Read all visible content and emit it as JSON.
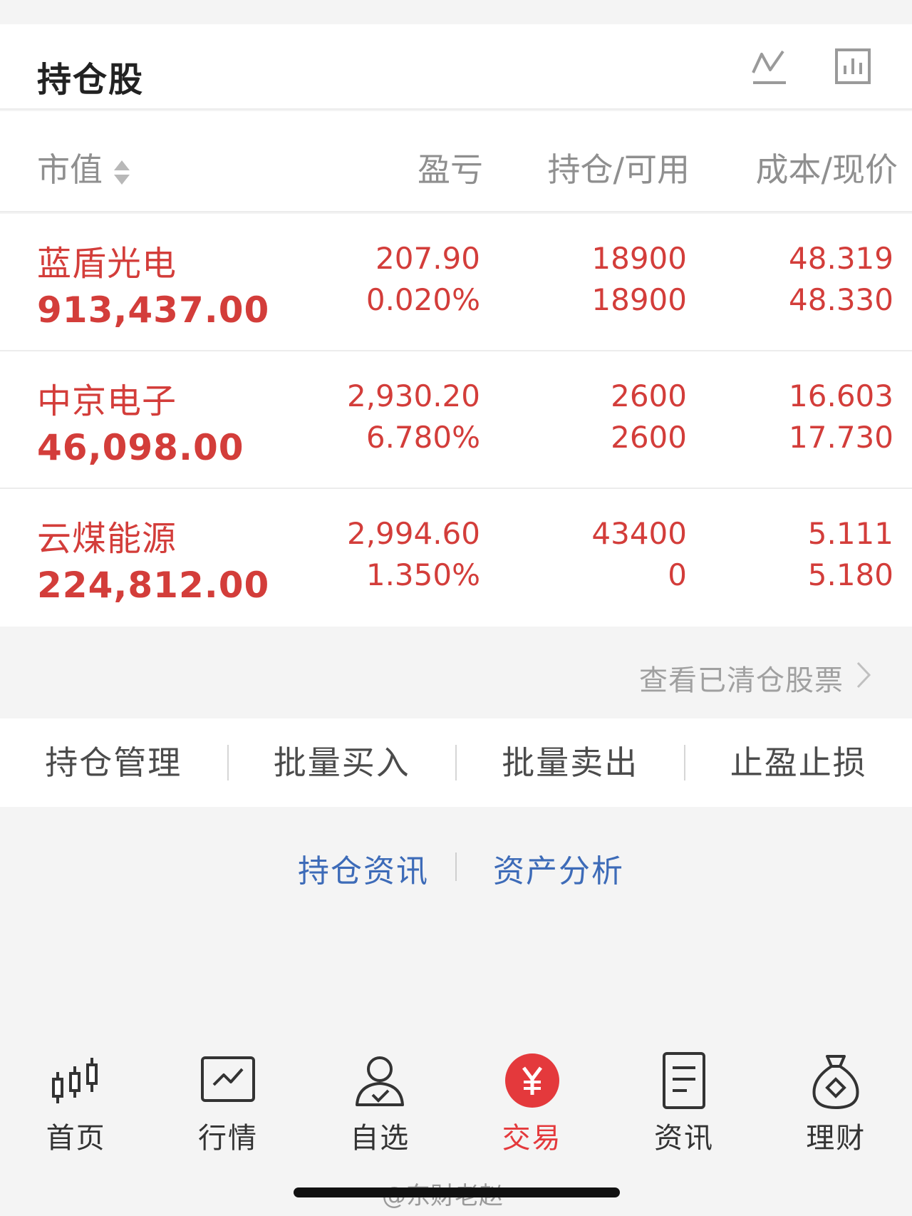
{
  "header": {
    "title": "持仓股",
    "icons": [
      "line-chart-icon",
      "bar-chart-icon"
    ]
  },
  "columns": {
    "market_value": "市值",
    "profit_loss": "盈亏",
    "position": "持仓/可用",
    "cost_price": "成本/现价"
  },
  "holdings": [
    {
      "name": "蓝盾光电",
      "market_value": "913,437.00",
      "pl_amount": "207.90",
      "pl_pct": "0.020%",
      "position": "18900",
      "available": "18900",
      "cost": "48.319",
      "price": "48.330"
    },
    {
      "name": "中京电子",
      "market_value": "46,098.00",
      "pl_amount": "2,930.20",
      "pl_pct": "6.780%",
      "position": "2600",
      "available": "2600",
      "cost": "16.603",
      "price": "17.730"
    },
    {
      "name": "云煤能源",
      "market_value": "224,812.00",
      "pl_amount": "2,994.60",
      "pl_pct": "1.350%",
      "position": "43400",
      "available": "0",
      "cost": "5.111",
      "price": "5.180"
    }
  ],
  "cleared_link": "查看已清仓股票",
  "actions": [
    "持仓管理",
    "批量买入",
    "批量卖出",
    "止盈止损"
  ],
  "info_links": [
    "持仓资讯",
    "资产分析"
  ],
  "tabbar": [
    {
      "label": "首页",
      "icon": "candlestick-icon"
    },
    {
      "label": "行情",
      "icon": "market-chart-icon"
    },
    {
      "label": "自选",
      "icon": "user-check-icon"
    },
    {
      "label": "交易",
      "icon": "yuan-icon",
      "active": true
    },
    {
      "label": "资讯",
      "icon": "document-icon"
    },
    {
      "label": "理财",
      "icon": "money-bag-icon"
    }
  ],
  "watermark": "@东财老赵",
  "colors": {
    "red": "#d33d3a",
    "accent_red": "#e4393c",
    "blue": "#3d6bb8",
    "grey_text": "#8f8f8f"
  }
}
